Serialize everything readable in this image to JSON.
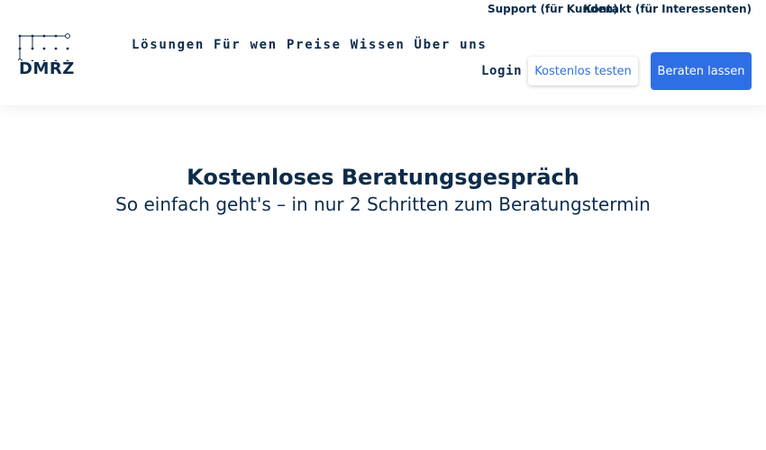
{
  "topbar": {
    "support_link": "Support (für Kunden)",
    "contact_link": "Kontakt (für Interessenten)"
  },
  "logo": {
    "text": "DMRZ",
    "icon": "dot-grid-logo-icon"
  },
  "nav": {
    "items": [
      {
        "label": "Lösungen"
      },
      {
        "label": "Für wen"
      },
      {
        "label": "Preise"
      },
      {
        "label": "Wissen"
      },
      {
        "label": "Über uns"
      }
    ]
  },
  "actions": {
    "login_label": "Login",
    "trial_label": "Kostenlos testen",
    "advise_label": "Beraten lassen"
  },
  "hero": {
    "title": "Kostenloses Beratungsgespräch",
    "subtitle": "So einfach geht's – in nur 2 Schritten zum Beratungstermin"
  },
  "colors": {
    "text": "#0d2c4b",
    "accent": "#2f6fe6",
    "background": "#ffffff"
  }
}
